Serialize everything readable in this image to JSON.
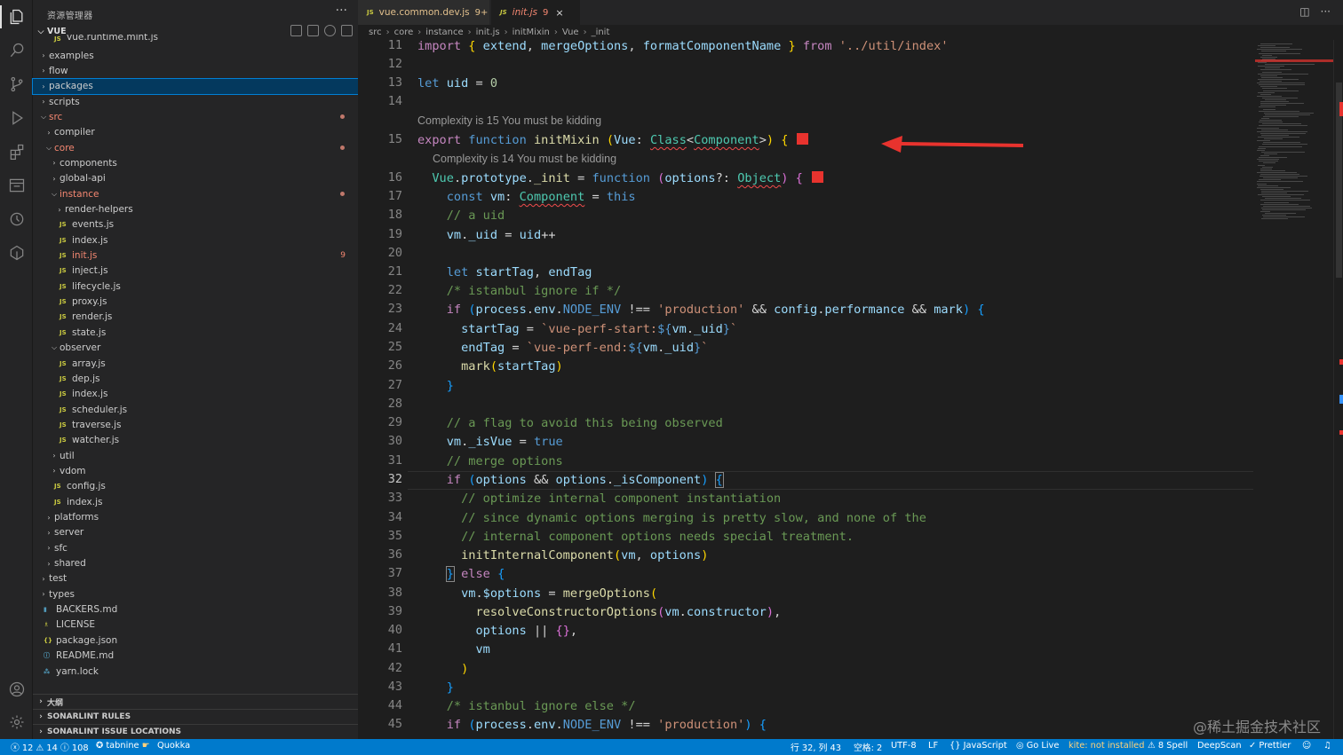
{
  "explorer": {
    "title": "资源管理器",
    "more": "···",
    "section": "VUE",
    "top_cut": "vue.runtime.mint.js",
    "items": [
      {
        "label": "examples",
        "kind": "folder",
        "depth": 1
      },
      {
        "label": "flow",
        "kind": "folder",
        "depth": 1
      },
      {
        "label": "packages",
        "kind": "folder",
        "depth": 1,
        "selected": true
      },
      {
        "label": "scripts",
        "kind": "folder",
        "depth": 1
      },
      {
        "label": "src",
        "kind": "folder-open",
        "depth": 1,
        "status": "err",
        "dot": true
      },
      {
        "label": "compiler",
        "kind": "folder",
        "depth": 2
      },
      {
        "label": "core",
        "kind": "folder-open",
        "depth": 2,
        "status": "err",
        "dot": true
      },
      {
        "label": "components",
        "kind": "folder",
        "depth": 3
      },
      {
        "label": "global-api",
        "kind": "folder",
        "depth": 3
      },
      {
        "label": "instance",
        "kind": "folder-open",
        "depth": 3,
        "status": "err",
        "dot": true
      },
      {
        "label": "render-helpers",
        "kind": "folder",
        "depth": 4
      },
      {
        "label": "events.js",
        "kind": "js",
        "depth": 4
      },
      {
        "label": "index.js",
        "kind": "js",
        "depth": 4
      },
      {
        "label": "init.js",
        "kind": "js",
        "depth": 4,
        "status": "err",
        "badge": "9"
      },
      {
        "label": "inject.js",
        "kind": "js",
        "depth": 4
      },
      {
        "label": "lifecycle.js",
        "kind": "js",
        "depth": 4
      },
      {
        "label": "proxy.js",
        "kind": "js",
        "depth": 4
      },
      {
        "label": "render.js",
        "kind": "js",
        "depth": 4
      },
      {
        "label": "state.js",
        "kind": "js",
        "depth": 4
      },
      {
        "label": "observer",
        "kind": "folder-open",
        "depth": 3
      },
      {
        "label": "array.js",
        "kind": "js",
        "depth": 4
      },
      {
        "label": "dep.js",
        "kind": "js",
        "depth": 4
      },
      {
        "label": "index.js",
        "kind": "js",
        "depth": 4
      },
      {
        "label": "scheduler.js",
        "kind": "js",
        "depth": 4
      },
      {
        "label": "traverse.js",
        "kind": "js",
        "depth": 4
      },
      {
        "label": "watcher.js",
        "kind": "js",
        "depth": 4
      },
      {
        "label": "util",
        "kind": "folder",
        "depth": 3
      },
      {
        "label": "vdom",
        "kind": "folder",
        "depth": 3
      },
      {
        "label": "config.js",
        "kind": "js",
        "depth": 3
      },
      {
        "label": "index.js",
        "kind": "js",
        "depth": 3
      },
      {
        "label": "platforms",
        "kind": "folder",
        "depth": 2
      },
      {
        "label": "server",
        "kind": "folder",
        "depth": 2
      },
      {
        "label": "sfc",
        "kind": "folder",
        "depth": 2
      },
      {
        "label": "shared",
        "kind": "folder",
        "depth": 2
      },
      {
        "label": "test",
        "kind": "folder",
        "depth": 1
      },
      {
        "label": "types",
        "kind": "folder",
        "depth": 1
      },
      {
        "label": "BACKERS.md",
        "kind": "md",
        "depth": 1
      },
      {
        "label": "LICENSE",
        "kind": "lic",
        "depth": 1
      },
      {
        "label": "package.json",
        "kind": "json",
        "depth": 1
      },
      {
        "label": "README.md",
        "kind": "info",
        "depth": 1
      },
      {
        "label": "yarn.lock",
        "kind": "lock",
        "depth": 1
      }
    ],
    "outline": "大纲",
    "sonar_rules": "SONARLINT RULES",
    "sonar_locations": "SONARLINT ISSUE LOCATIONS"
  },
  "tabs": [
    {
      "label": "vue.common.dev.js",
      "count": "9+",
      "icon": "JS"
    },
    {
      "label": "init.js",
      "count": "9",
      "icon": "JS",
      "close": "×"
    }
  ],
  "breadcrumbs": [
    "src",
    "core",
    "instance",
    "init.js",
    "initMixin",
    "Vue",
    "_init"
  ],
  "code_lens": {
    "line15": "Complexity is 15 You must be kidding",
    "line16": "Complexity is 14 You must be kidding"
  },
  "line_numbers": [
    "11",
    "12",
    "13",
    "14",
    "15",
    "16",
    "17",
    "18",
    "19",
    "20",
    "21",
    "22",
    "23",
    "24",
    "25",
    "26",
    "27",
    "28",
    "29",
    "30",
    "31",
    "32",
    "33",
    "34",
    "35",
    "36",
    "37",
    "38",
    "39",
    "40",
    "41",
    "42",
    "43",
    "44",
    "45"
  ],
  "current_line": "32",
  "status": {
    "errors": "12",
    "warnings": "14",
    "infos": "108",
    "tabnine": "tabnine",
    "quokka": "Quokka",
    "position": "行 32, 列 43",
    "spaces": "空格: 2",
    "encoding": "UTF-8",
    "eol": "LF",
    "language": "JavaScript",
    "golive": "Go Live",
    "kite": "kite: not installed",
    "spell": "8 Spell",
    "deepscan": "DeepScan",
    "prettier": "Prettier"
  },
  "watermark": "@稀土掘金技术社区",
  "colors": {
    "accent": "#007acc",
    "error": "#f48771",
    "marker": "#e8332e",
    "arrow": "#e8332e"
  }
}
